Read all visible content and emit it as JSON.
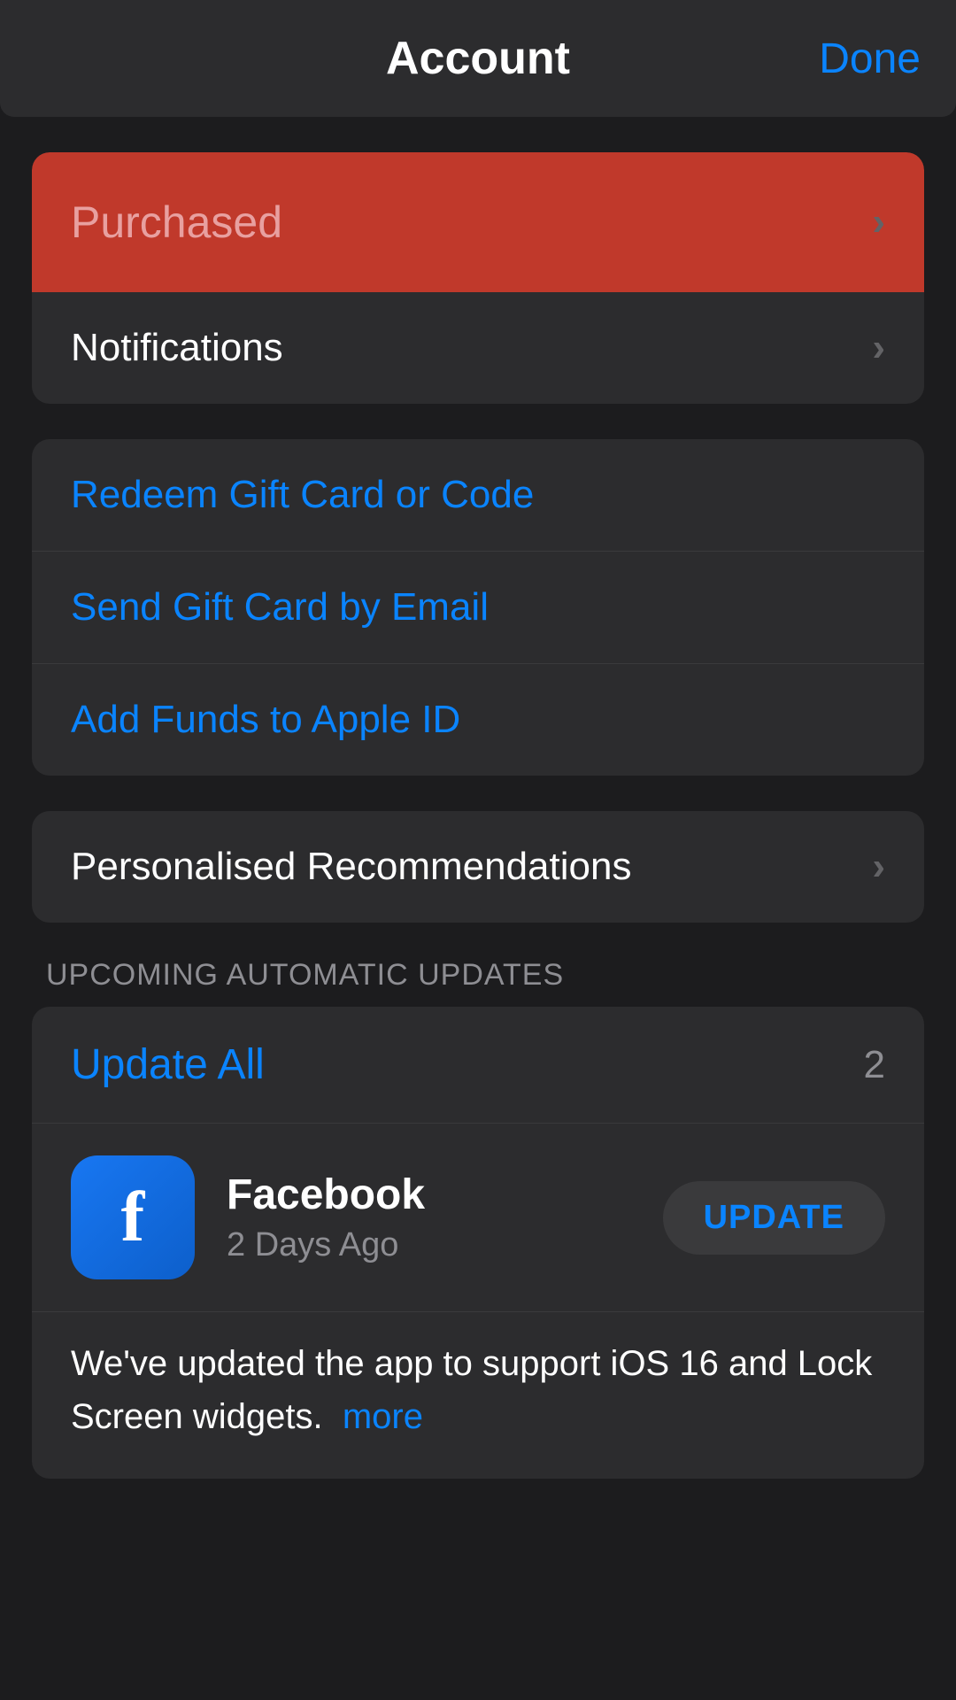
{
  "header": {
    "title": "Account",
    "done_label": "Done"
  },
  "section1": {
    "items": [
      {
        "label": "Purchased",
        "type": "purchased"
      },
      {
        "label": "Notifications",
        "type": "chevron"
      }
    ]
  },
  "section2": {
    "items": [
      {
        "label": "Redeem Gift Card or Code",
        "type": "blue"
      },
      {
        "label": "Send Gift Card by Email",
        "type": "blue"
      },
      {
        "label": "Add Funds to Apple ID",
        "type": "blue"
      }
    ]
  },
  "section3": {
    "items": [
      {
        "label": "Personalised Recommendations",
        "type": "chevron"
      }
    ]
  },
  "upcoming_section_label": "UPCOMING AUTOMATIC UPDATES",
  "updates_section": {
    "update_all_label": "Update All",
    "update_count": "2",
    "app": {
      "name": "Facebook",
      "date": "2 Days Ago",
      "update_button_label": "UPDATE",
      "description": "We've updated the app to support iOS 16 and Lock Screen widgets.",
      "more_label": "more"
    }
  }
}
